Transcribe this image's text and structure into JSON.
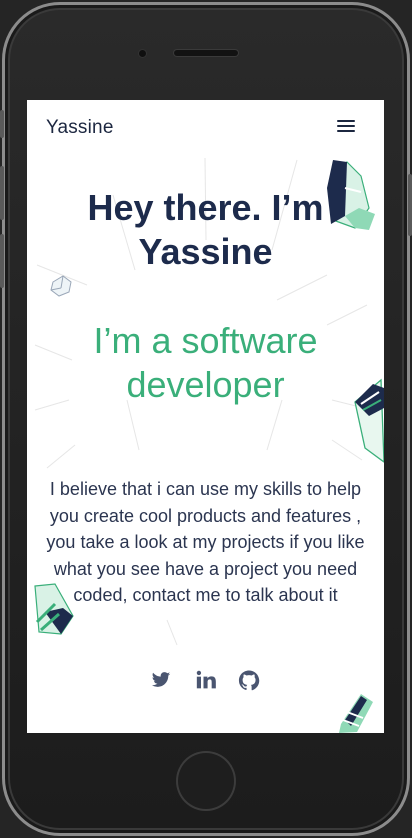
{
  "navbar": {
    "brand": "Yassine",
    "menu_icon": "hamburger-menu-icon"
  },
  "hero": {
    "title": "Hey there. I’m Yassine",
    "subtitle": "I’m a software developer",
    "description": "I believe that i can use my skills to help you create cool products and features , you take a look at my projects if you like what you see have a project you need coded, contact me to talk about it"
  },
  "socials": [
    {
      "icon": "twitter-icon"
    },
    {
      "icon": "linkedin-icon"
    },
    {
      "icon": "github-icon"
    }
  ],
  "colors": {
    "accent": "#3aaf7a",
    "title": "#1d2b4c",
    "text": "#2b3550",
    "icons": "#4a5570",
    "background": "#ffffff"
  }
}
